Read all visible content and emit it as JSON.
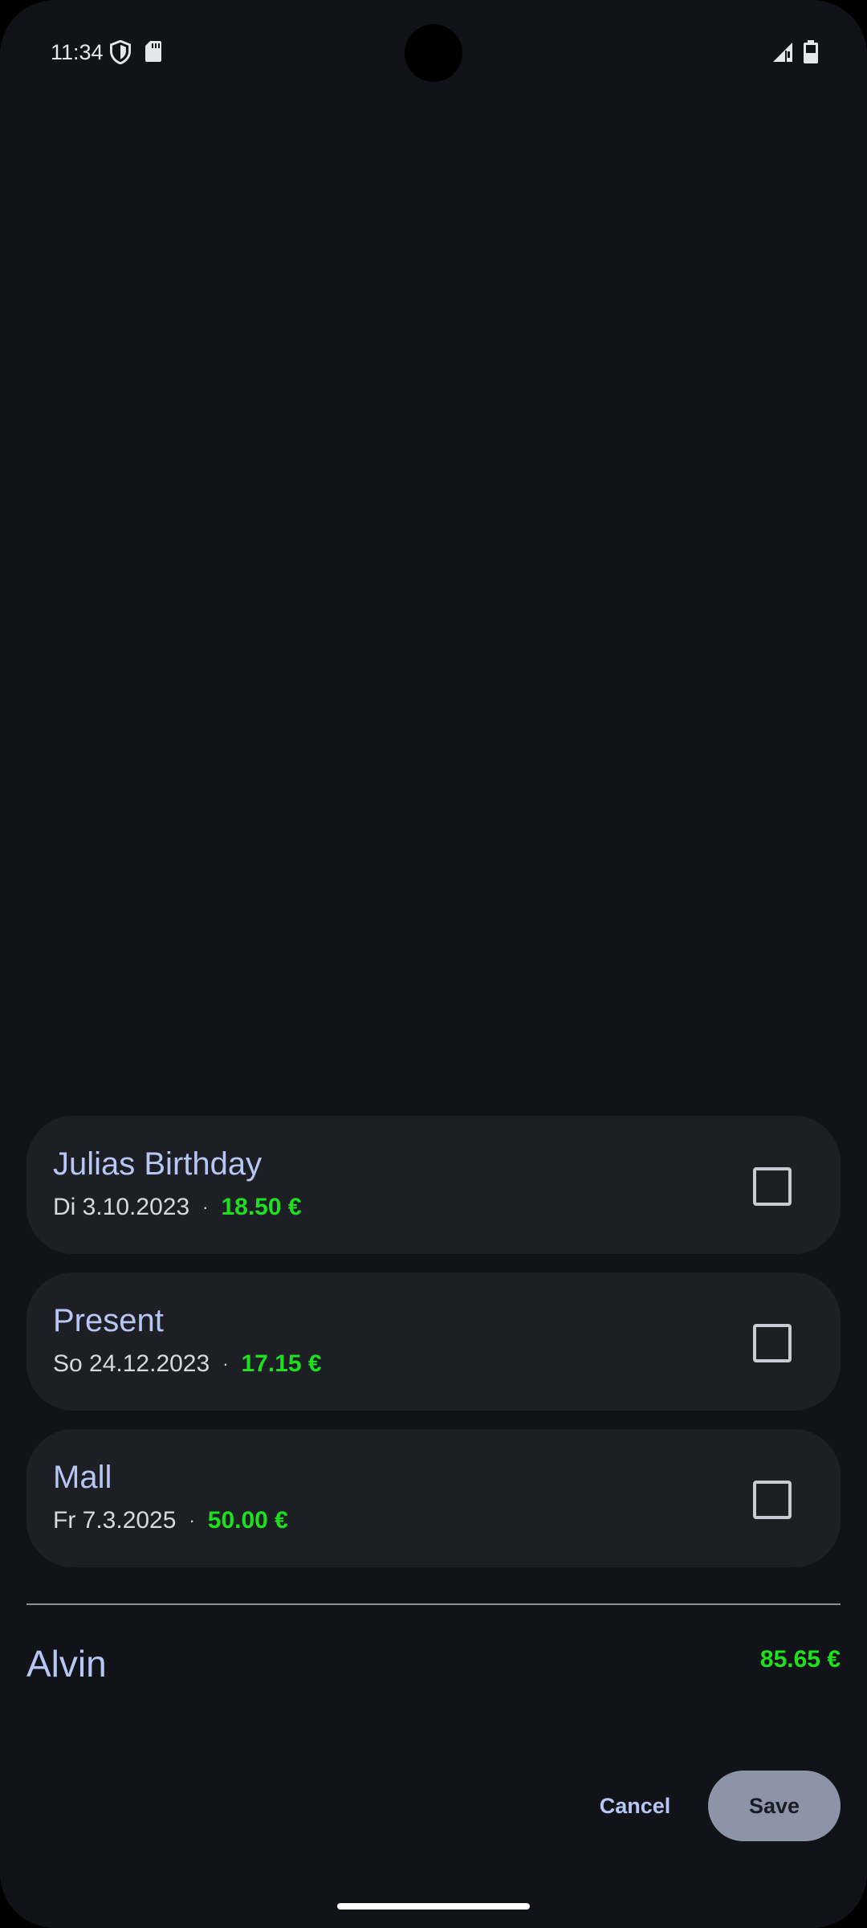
{
  "status_bar": {
    "time": "11:34",
    "icons": [
      "shield-icon",
      "sd-card-icon",
      "signal-icon",
      "battery-icon"
    ]
  },
  "items": [
    {
      "title": "Julias Birthday",
      "date": "Di 3.10.2023",
      "separator": "·",
      "amount": "18.50 €",
      "checked": false
    },
    {
      "title": "Present",
      "date": "So 24.12.2023",
      "separator": "·",
      "amount": "17.15 €",
      "checked": false
    },
    {
      "title": "Mall",
      "date": "Fr 7.3.2025",
      "separator": "·",
      "amount": "50.00 €",
      "checked": false
    }
  ],
  "summary": {
    "name": "Alvin",
    "total": "85.65 €"
  },
  "actions": {
    "cancel_label": "Cancel",
    "save_label": "Save"
  },
  "colors": {
    "background": "#121318",
    "card": "#1e1f25",
    "title": "#b6c6f5",
    "amount": "#1fe01f",
    "save_button": "#8e94a8"
  }
}
